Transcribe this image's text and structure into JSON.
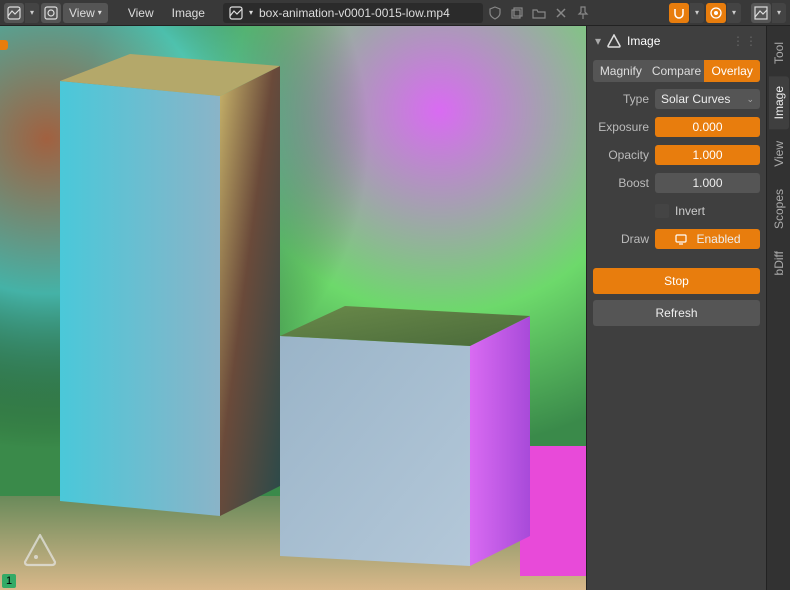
{
  "toolbar": {
    "view_dropdown": "View",
    "menu_view": "View",
    "menu_image": "Image",
    "filename": "box-animation-v0001-0015-low.mp4"
  },
  "viewport": {
    "frame": "1"
  },
  "panel": {
    "title": "Image",
    "tabs": {
      "magnify": "Magnify",
      "compare": "Compare",
      "overlay": "Overlay",
      "active": "Overlay"
    },
    "type_label": "Type",
    "type_value": "Solar Curves",
    "exposure_label": "Exposure",
    "exposure_value": "0.000",
    "opacity_label": "Opacity",
    "opacity_value": "1.000",
    "boost_label": "Boost",
    "boost_value": "1.000",
    "invert_label": "Invert",
    "draw_label": "Draw",
    "draw_value": "Enabled",
    "stop": "Stop",
    "refresh": "Refresh"
  },
  "side_tabs": [
    "Tool",
    "Image",
    "View",
    "Scopes",
    "bDiff"
  ],
  "side_active": "Image"
}
